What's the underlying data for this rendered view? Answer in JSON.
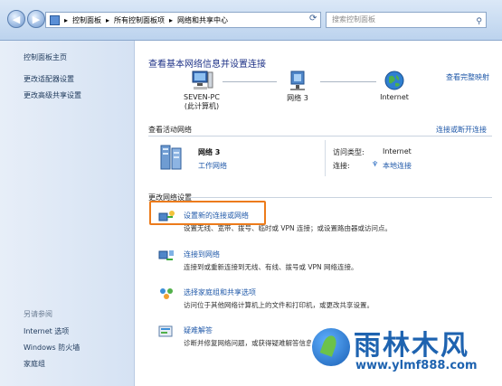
{
  "address_bar": {
    "crumbs": [
      "控制面板",
      "所有控制面板项",
      "网络和共享中心"
    ]
  },
  "search": {
    "placeholder": "搜索控制面板"
  },
  "sidebar": {
    "items": [
      "控制面板主页",
      "更改适配器设置",
      "更改高级共享设置"
    ],
    "see_also_title": "另请参阅",
    "see_also": [
      "Internet 选项",
      "Windows 防火墙",
      "家庭组"
    ]
  },
  "main": {
    "title": "查看基本网络信息并设置连接",
    "full_map": "查看完整映射",
    "map": {
      "pc_name": "SEVEN-PC",
      "pc_sub": "(此计算机)",
      "network": "网络  3",
      "internet": "Internet"
    },
    "active_title": "查看活动网络",
    "connect_disconnect": "连接或断开连接",
    "active": {
      "name": "网络  3",
      "type": "工作网络",
      "access_label": "访问类型:",
      "access_value": "Internet",
      "conn_label": "连接:",
      "conn_value": "本地连接"
    },
    "change_title": "更改网络设置",
    "tasks": [
      {
        "title": "设置新的连接或网络",
        "desc": "设置无线、宽带、拨号、临时或 VPN 连接；或设置路由器或访问点。"
      },
      {
        "title": "连接到网络",
        "desc": "连接到或重新连接到无线、有线、拨号或 VPN 网络连接。"
      },
      {
        "title": "选择家庭组和共享选项",
        "desc": "访问位于其他网络计算机上的文件和打印机，或更改共享设置。"
      },
      {
        "title": "疑难解答",
        "desc": "诊断并修复网络问题，或获得疑难解答信息。"
      }
    ]
  },
  "watermark": {
    "brand": "雨林木风",
    "url": "www.ylmf888.com"
  },
  "colors": {
    "highlight": "#ec7b1b",
    "link": "#2059a9",
    "watermark": "#1e63b0"
  }
}
